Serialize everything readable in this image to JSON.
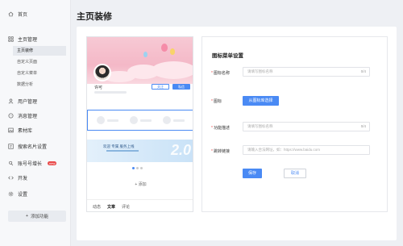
{
  "sidebar": {
    "home_label": "首页",
    "items": [
      {
        "label": "主页管理",
        "icon": "grid-icon"
      },
      {
        "label": "用户管理",
        "icon": "user-icon"
      },
      {
        "label": "消息管理",
        "icon": "message-icon"
      },
      {
        "label": "素材库",
        "icon": "image-icon"
      },
      {
        "label": "搜索名片设置",
        "icon": "card-icon"
      },
      {
        "label": "账号号增长",
        "icon": "growth-icon",
        "badge": "new"
      },
      {
        "label": "开发",
        "icon": "code-icon"
      },
      {
        "label": "设置",
        "icon": "gear-icon"
      }
    ],
    "subitems": [
      "主页装修",
      "自定义页面",
      "自定义菜单",
      "数据分析"
    ],
    "add_function_label": "添加功能"
  },
  "header": {
    "title": "主页装修"
  },
  "preview": {
    "user_name": "许可",
    "follow_label": "关注",
    "message_label": "私信",
    "promo_text": "欢迎 专属 服务上线 ",
    "promo_number": "2.0",
    "add_module_label": "+ 添加",
    "tabs": [
      "动态",
      "文章",
      "评论"
    ]
  },
  "form": {
    "title": "图标菜单设置",
    "fields": {
      "name": {
        "label": "图标名称",
        "placeholder": "请填写图标名称",
        "count": "0/4"
      },
      "icon": {
        "label": "图标",
        "button": "从图标库选择"
      },
      "desc": {
        "label": "功能描述",
        "placeholder": "请填写图标名称",
        "count": "0/4"
      },
      "link": {
        "label": "跳转链接",
        "placeholder": "请输入合法网址，如：https://www.baidu.com"
      }
    },
    "save_label": "保存",
    "cancel_label": "取消"
  },
  "colors": {
    "accent": "#4a8af4",
    "required": "#e94b4b"
  }
}
